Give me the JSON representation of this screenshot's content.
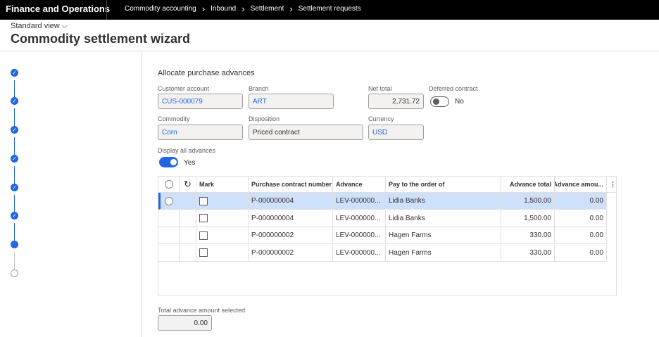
{
  "app": {
    "title": "Finance and Operations",
    "breadcrumbs": [
      "Commodity accounting",
      "Inbound",
      "Settlement",
      "Settlement requests"
    ]
  },
  "page": {
    "view": "Standard view",
    "title": "Commodity settlement wizard"
  },
  "wizard": {
    "steps": [
      "complete",
      "complete",
      "complete",
      "complete",
      "complete",
      "complete",
      "current",
      "pending"
    ]
  },
  "form": {
    "section": "Allocate purchase advances",
    "customer_account": {
      "label": "Customer account",
      "value": "CUS-000079"
    },
    "branch": {
      "label": "Branch",
      "value": "ART"
    },
    "net_total": {
      "label": "Net total",
      "value": "2,731.72"
    },
    "deferred_contract": {
      "label": "Deferred contract",
      "value": "No",
      "on": false
    },
    "commodity": {
      "label": "Commodity",
      "value": "Corn"
    },
    "disposition": {
      "label": "Disposition",
      "value": "Priced contract"
    },
    "currency": {
      "label": "Currency",
      "value": "USD"
    },
    "display_all": {
      "label": "Display all advances",
      "value": "Yes",
      "on": true
    }
  },
  "grid": {
    "columns": [
      "Mark",
      "Purchase contract number",
      "Advance",
      "Pay to the order of",
      "Advance total",
      "Advance amou..."
    ],
    "rows": [
      {
        "contract": "P-000000004",
        "advance": "LEV-000000...",
        "payee": "Lidia Banks",
        "total": "1,500.00",
        "amount": "0.00"
      },
      {
        "contract": "P-000000004",
        "advance": "LEV-000000...",
        "payee": "Lidia Banks",
        "total": "1,500.00",
        "amount": "0.00"
      },
      {
        "contract": "P-000000002",
        "advance": "LEV-000000...",
        "payee": "Hagen Farms",
        "total": "330.00",
        "amount": "0.00"
      },
      {
        "contract": "P-000000002",
        "advance": "LEV-000000...",
        "payee": "Hagen Farms",
        "total": "330.00",
        "amount": "0.00"
      }
    ]
  },
  "total": {
    "label": "Total advance amount selected",
    "value": "0.00"
  }
}
